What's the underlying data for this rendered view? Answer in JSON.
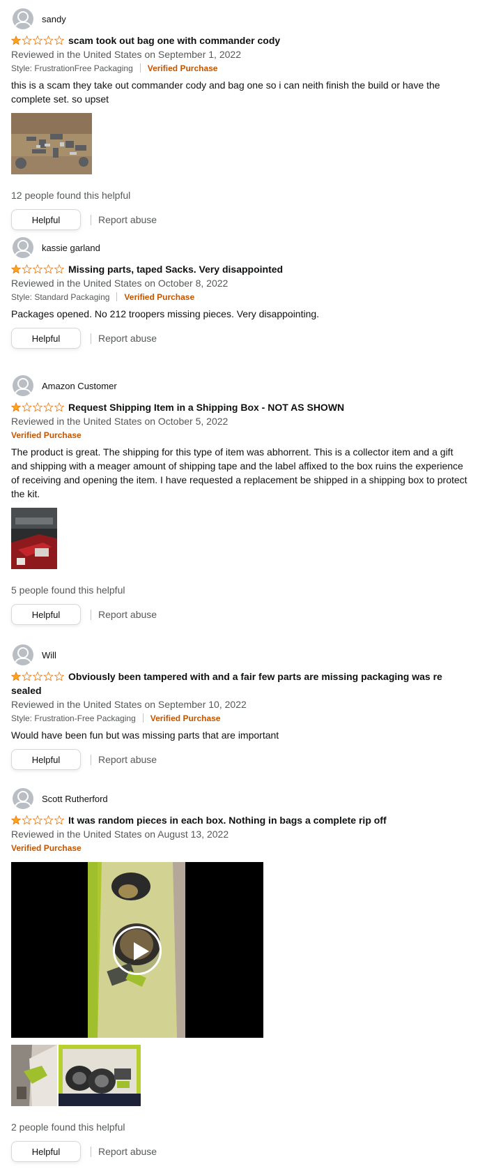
{
  "reviews": [
    {
      "name": "sandy",
      "rating": 1,
      "title": "scam took out bag one with commander cody",
      "meta": "Reviewed in the United States on September 1, 2022",
      "style": "Style: FrustrationFree Packaging",
      "verified": "Verified Purchase",
      "body": "this is a scam they take out commander cody and bag one so i can neith finish the build or have the complete set. so upset",
      "helpful_count": "12 people found this helpful",
      "helpful_label": "Helpful",
      "report_label": "Report abuse"
    },
    {
      "name": "kassie garland",
      "rating": 1,
      "title": "Missing parts, taped Sacks. Very disappointed",
      "meta": "Reviewed in the United States on October 8, 2022",
      "style": "Style: Standard Packaging",
      "verified": "Verified Purchase",
      "body": "Packages opened. No 212 troopers missing pieces. Very disappointing.",
      "helpful_label": "Helpful",
      "report_label": "Report abuse"
    },
    {
      "name": "Amazon Customer",
      "rating": 1,
      "title": "Request Shipping Item in a Shipping Box - NOT AS SHOWN",
      "meta": "Reviewed in the United States on October 5, 2022",
      "verified": "Verified Purchase",
      "body": "The product is great. The shipping for this type of item was abhorrent. This is a collector item and a gift and shipping with a meager amount of shipping tape and the label affixed to the box ruins the experience of receiving and opening the item. I have requested a replacement be shipped in a shipping box to protect the kit.",
      "helpful_count": "5 people found this helpful",
      "helpful_label": "Helpful",
      "report_label": "Report abuse"
    },
    {
      "name": "Will",
      "rating": 1,
      "title": "Obviously been tampered with and a fair few parts are missing packaging was re sealed",
      "meta": "Reviewed in the United States on September 10, 2022",
      "style": "Style: Frustration-Free Packaging",
      "verified": "Verified Purchase",
      "body": "Would have been fun but was missing parts that are important",
      "helpful_label": "Helpful",
      "report_label": "Report abuse"
    },
    {
      "name": "Scott Rutherford",
      "rating": 1,
      "title": "It was random pieces in each box. Nothing in bags a complete rip off",
      "meta": "Reviewed in the United States on August 13, 2022",
      "verified": "Verified Purchase",
      "helpful_count": "2 people found this helpful",
      "helpful_label": "Helpful",
      "report_label": "Report abuse"
    }
  ],
  "colors": {
    "star": "#ffa41c",
    "verified": "#c45500",
    "meta": "#565959"
  }
}
